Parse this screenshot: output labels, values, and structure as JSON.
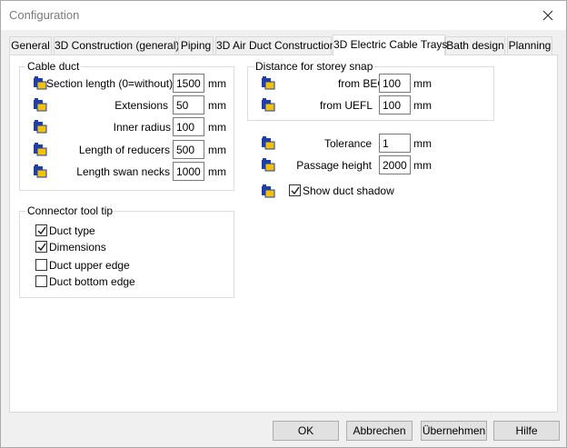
{
  "window": {
    "title": "Configuration"
  },
  "tabs": [
    {
      "label": "General"
    },
    {
      "label": "3D Construction (general)"
    },
    {
      "label": "Piping"
    },
    {
      "label": "3D Air Duct Construction"
    },
    {
      "label": "3D Electric Cable Trays",
      "active": true
    },
    {
      "label": "Bath design"
    },
    {
      "label": "Planning"
    }
  ],
  "cable_duct": {
    "title": "Cable duct",
    "rows": [
      {
        "label": "Section length (0=without)",
        "value": "1500",
        "unit": "mm"
      },
      {
        "label": "Extensions",
        "value": "50",
        "unit": "mm"
      },
      {
        "label": "Inner radius",
        "value": "100",
        "unit": "mm"
      },
      {
        "label": "Length of reducers",
        "value": "500",
        "unit": "mm"
      },
      {
        "label": "Length swan necks",
        "value": "1000",
        "unit": "mm"
      }
    ]
  },
  "storey_snap": {
    "title": "Distance for storey snap",
    "rows": [
      {
        "label": "from BEC",
        "value": "100",
        "unit": "mm"
      },
      {
        "label": "from UEFL",
        "value": "100",
        "unit": "mm"
      }
    ]
  },
  "misc": {
    "rows": [
      {
        "label": "Tolerance",
        "value": "1",
        "unit": "mm"
      },
      {
        "label": "Passage height",
        "value": "2000",
        "unit": "mm"
      }
    ],
    "show_shadow": {
      "label": "Show duct shadow",
      "checked": true
    }
  },
  "connector_tooltip": {
    "title": "Connector tool tip",
    "items": [
      {
        "label": "Duct type",
        "checked": true
      },
      {
        "label": "Dimensions",
        "checked": true
      },
      {
        "label": "Duct upper edge",
        "checked": false
      },
      {
        "label": "Duct bottom edge",
        "checked": false
      }
    ]
  },
  "buttons": {
    "ok": "OK",
    "cancel": "Abbrechen",
    "apply": "Übernehmen",
    "help": "Hilfe"
  },
  "colors": {
    "icon_blue": "#1f3ea8",
    "icon_yellow": "#f2c200",
    "window_bg": "#f0f0f0",
    "panel_bg": "#ffffff"
  }
}
